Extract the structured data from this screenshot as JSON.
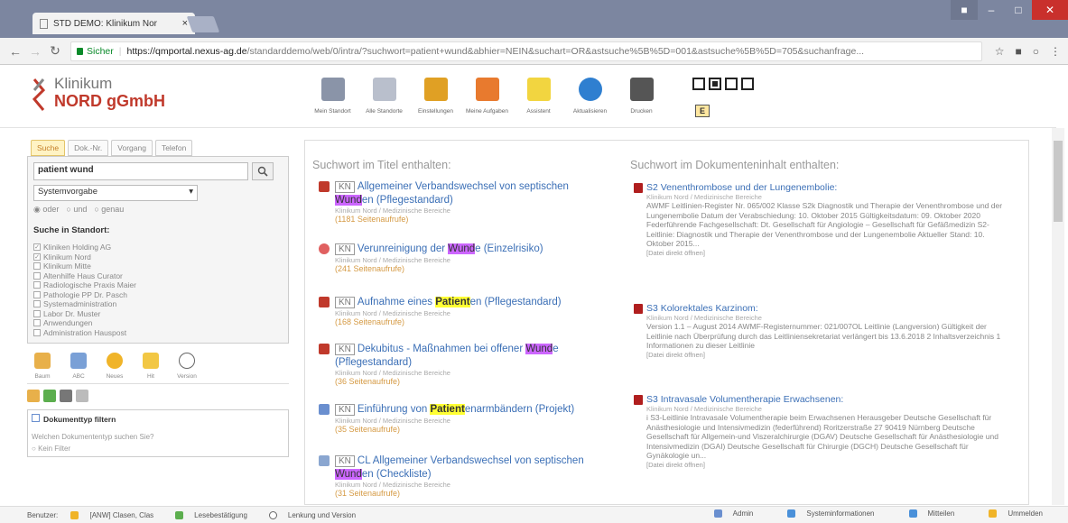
{
  "browser": {
    "tab_title": "STD DEMO: Klinikum Nor",
    "tab_close": "×",
    "url_secure": "Sicher",
    "url_domain": "https://qmportal.nexus-ag.de",
    "url_rest": "/standarddemo/web/0/intra/?suchwort=patient+wund&abhier=NEIN&suchart=OR&astsuche%5B%5D=001&astsuche%5B%5D=705&suchanfrage..."
  },
  "logo": {
    "line1": "Klinikum",
    "line2": "NORD gGmbH"
  },
  "toolbar": {
    "items": [
      {
        "label": "Mein Standort",
        "color": "#8a94a8"
      },
      {
        "label": "Alle Standorte",
        "color": "#b9bfcc"
      },
      {
        "label": "Einstellungen",
        "color": "#e0a024"
      },
      {
        "label": "Meine Aufgaben",
        "color": "#e87a2e"
      },
      {
        "label": "Assistent",
        "color": "#f2d540"
      },
      {
        "label": "Aktualisieren",
        "color": "#2f7fd0"
      },
      {
        "label": "Drucken",
        "color": "#555"
      }
    ],
    "e_label": "E"
  },
  "sidebar": {
    "tabs": [
      "Suche",
      "Dok.-Nr.",
      "Vorgang",
      "Telefon"
    ],
    "search_value": "patient wund",
    "select_value": "Systemvorgabe",
    "radios": [
      "oder",
      "und",
      "genau"
    ],
    "standort_heading": "Suche in Standort:",
    "standorte": [
      {
        "label": "Kliniken Holding AG",
        "checked": true
      },
      {
        "label": "Klinikum Nord",
        "checked": true
      },
      {
        "label": "Klinikum Mitte",
        "checked": false
      },
      {
        "label": "Altenhilfe Haus Curator",
        "checked": false
      },
      {
        "label": "Radiologische Praxis Maier",
        "checked": false
      },
      {
        "label": "Pathologie PP Dr. Pasch",
        "checked": false
      },
      {
        "label": "Systemadministration",
        "checked": false
      },
      {
        "label": "Labor Dr. Muster",
        "checked": false
      },
      {
        "label": "Anwendungen",
        "checked": false
      },
      {
        "label": "Administration Hauspost",
        "checked": false
      }
    ],
    "nav_icons": [
      {
        "label": "Baum",
        "color": "#e8b04a"
      },
      {
        "label": "ABC",
        "color": "#7aa0d6"
      },
      {
        "label": "Neues",
        "color": "#f0b429"
      },
      {
        "label": "Hit",
        "color": "#f2c744"
      },
      {
        "label": "Version",
        "color": "#ffffff"
      }
    ],
    "filter_heading": "Dokumenttyp filtern",
    "filter_question": "Welchen Dokumententyp suchen Sie?",
    "filter_option": "Kein Filter"
  },
  "main": {
    "title_col_head": "Suchwort im Titel enthalten:",
    "content_col_head": "Suchwort im Dokumenteninhalt enthalten:",
    "title_results": [
      {
        "kn": "KN",
        "pre": "Allgemeiner Verbandswechsel von septischen ",
        "hl": "Wund",
        "post": "en (Pflegestandard)",
        "hl_type": "m",
        "sub": "Klinikum Nord / Medizinische Bereiche",
        "count": "(1181 Seitenaufrufe)",
        "icon": "#c0392b"
      },
      {
        "kn": "KN",
        "pre": "Verunreinigung der ",
        "hl": "Wund",
        "post": "e (Einzelrisiko)",
        "hl_type": "m",
        "sub": "Klinikum Nord / Medizinische Bereiche",
        "count": "(241 Seitenaufrufe)",
        "icon": "#e06060"
      },
      {
        "kn": "KN",
        "pre": "Aufnahme eines ",
        "hl": "Patient",
        "post": "en (Pflegestandard)",
        "hl_type": "y",
        "sub": "Klinikum Nord / Medizinische Bereiche",
        "count": "(168 Seitenaufrufe)",
        "icon": "#c0392b"
      },
      {
        "kn": "KN",
        "pre": "Dekubitus - Maßnahmen bei offener ",
        "hl": "Wund",
        "post": "e (Pflegestandard)",
        "hl_type": "m",
        "sub": "Klinikum Nord / Medizinische Bereiche",
        "count": "(36 Seitenaufrufe)",
        "icon": "#c0392b"
      },
      {
        "kn": "KN",
        "pre": "Einführung von ",
        "hl": "Patient",
        "post": "enarmbändern (Projekt)",
        "hl_type": "y",
        "sub": "Klinikum Nord / Medizinische Bereiche",
        "count": "(35 Seitenaufrufe)",
        "icon": "#6a8fcf"
      },
      {
        "kn": "KN",
        "pre": "CL Allgemeiner Verbandswechsel von septischen ",
        "hl": "Wund",
        "post": "en (Checkliste)",
        "hl_type": "m",
        "sub": "Klinikum Nord / Medizinische Bereiche",
        "count": "(31 Seitenaufrufe)",
        "icon": "#8aa6d0"
      }
    ],
    "content_results": [
      {
        "title": "S2 Venenthrombose und der Lungenembolie:",
        "sub": "Klinikum Nord / Medizinische Bereiche",
        "body": "AWMF Leitlinien-Register Nr. 065/002 Klasse S2k Diagnostik und Therapie der Venenthrombose und der Lungenembolie Datum der Verabschiedung: 10. Oktober 2015 Gültigkeitsdatum: 09. Oktober 2020 Federführende Fachgesellschaft: Dt. Gesellschaft für Angiologie – Gesellschaft für Gefäßmedizin S2-Leitlinie: Diagnostik und Therapie der Venenthrombose und der Lungenembolie Aktueller Stand: 10. Oktober 2015...",
        "link": "[Datei direkt öffnen]"
      },
      {
        "title": "S3 Kolorektales Karzinom:",
        "sub": "Klinikum Nord / Medizinische Bereiche",
        "body": "Version 1.1 – August 2014 AWMF-Registernummer: 021/007OL Leitlinie (Langversion) Gültigkeit der Leitlinie nach Überprüfung durch das Leitliniensekretariat verlängert bis 13.6.2018 2 Inhaltsverzeichnis 1 Informationen zu dieser Leitlinie",
        "link": "[Datei direkt öffnen]"
      },
      {
        "title": "S3 Intravasale Volumentherapie Erwachsenen:",
        "sub": "Klinikum Nord / Medizinische Bereiche",
        "body": "i S3-Leitlinie Intravasale Volumentherapie beim Erwachsenen Herausgeber Deutsche Gesellschaft für Anästhesiologie und Intensivmedizin (federführend) Roritzerstraße 27 90419 Nürnberg Deutsche Gesellschaft für Allgemein-und Viszeralchirurgie (DGAV) Deutsche Gesellschaft für Anästhesiologie und Intensivmedizin (DGAI) Deutsche Gesellschaft für Chirurgie (DGCH) Deutsche Gesellschaft für Gynäkologie un...",
        "link": "[Datei direkt öffnen]"
      }
    ]
  },
  "statusbar": {
    "user_label": "Benutzer:",
    "user_value": "[ANW] Clasen, Clas",
    "lesebest": "Lesebestätigung",
    "lenkung": "Lenkung und Version",
    "right": [
      "Admin",
      "Systeminformationen",
      "Mitteilen",
      "Ummelden"
    ]
  }
}
